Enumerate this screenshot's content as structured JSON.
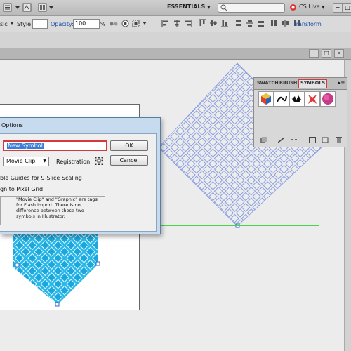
{
  "app_bar": {
    "workspace": "ESSENTIALS",
    "search_placeholder": "",
    "cs_live": "CS Live"
  },
  "control_bar": {
    "basic_suffix": "sic",
    "style_label": "Style:",
    "opacity_label": "Opacity:",
    "opacity_value": "100",
    "opacity_unit": "%",
    "transform_link": "Transform"
  },
  "symbols_panel": {
    "tabs": [
      "SWATCH",
      "BRUSH",
      "SYMBOLS"
    ],
    "active_tab": "SYMBOLS"
  },
  "dialog": {
    "title": "Options",
    "name_value": "New Symbol",
    "ok_label": "OK",
    "cancel_label": "Cancel",
    "type_value": "Movie Clip",
    "registration_label": "Registration:",
    "guides_label": "ble Guides for 9-Slice Scaling",
    "pixel_grid_label": "gn to Pixel Grid",
    "note_lines": [
      "\"Movie Clip\" and \"Graphic\" are tags",
      "for Flash import. There is no",
      "difference between these two",
      "symbols in Illustrator."
    ]
  },
  "colors": {
    "accent_blue": "#29b8e8",
    "highlight_red": "#d43a3a",
    "guide_green": "#49d549",
    "selection_blue": "#3b7ed8"
  }
}
